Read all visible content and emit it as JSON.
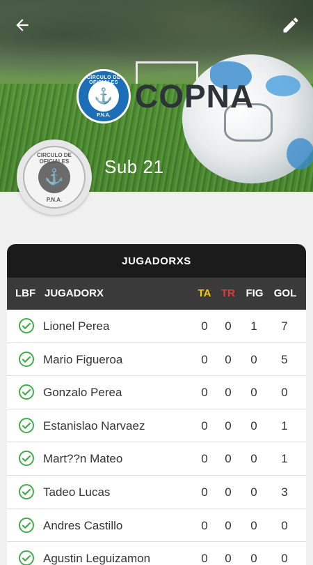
{
  "header": {
    "brand_seal_top": "CIRCULO DE OFICIALES",
    "brand_seal_bottom": "P.N.A.",
    "brand_word": "COPNA",
    "team_name": "Sub 21",
    "back_icon": "arrow-left-icon",
    "edit_icon": "pencil-icon"
  },
  "avatar": {
    "seal_top": "CIRCULO DE OFICIALES",
    "seal_bottom": "P.N.A."
  },
  "table": {
    "title": "JUGADORXS",
    "columns": {
      "lbf": "LBF",
      "player": "JUGADORX",
      "ta": "TA",
      "tr": "TR",
      "fig": "FIG",
      "gol": "GOL"
    },
    "colors": {
      "ta": "#f4d000",
      "tr": "#e03a3a",
      "check": "#3fae49"
    },
    "rows": [
      {
        "name": "Lionel Perea",
        "ta": "0",
        "tr": "0",
        "fig": "1",
        "gol": "7"
      },
      {
        "name": "Mario Figueroa",
        "ta": "0",
        "tr": "0",
        "fig": "0",
        "gol": "5"
      },
      {
        "name": "Gonzalo Perea",
        "ta": "0",
        "tr": "0",
        "fig": "0",
        "gol": "0"
      },
      {
        "name": "Estanislao Narvaez",
        "ta": "0",
        "tr": "0",
        "fig": "0",
        "gol": "1"
      },
      {
        "name": "Mart??n Mateo",
        "ta": "0",
        "tr": "0",
        "fig": "0",
        "gol": "1"
      },
      {
        "name": "Tadeo Lucas",
        "ta": "0",
        "tr": "0",
        "fig": "0",
        "gol": "3"
      },
      {
        "name": "Andres Castillo",
        "ta": "0",
        "tr": "0",
        "fig": "0",
        "gol": "0"
      },
      {
        "name": "Agustin Leguizamon",
        "ta": "0",
        "tr": "0",
        "fig": "0",
        "gol": "0"
      }
    ]
  }
}
